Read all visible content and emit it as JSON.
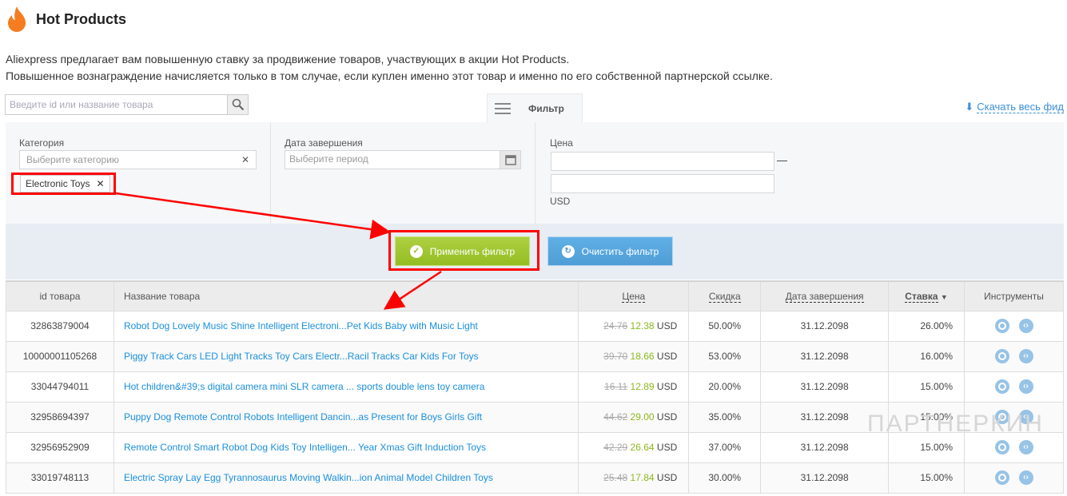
{
  "header": {
    "title": "Hot Products",
    "icon": "flame-icon"
  },
  "intro": [
    "Aliexpress предлагает вам повышенную ставку за продвижение товаров, участвующих в акции Hot Products.",
    "Повышенное вознаграждение начисляется только в том случае, если куплен именно этот товар и именно по его собственной партнерской ссылке."
  ],
  "search": {
    "placeholder": "Введите id или название товара"
  },
  "filter_tab": "Фильтр",
  "download": "Скачать весь фид",
  "filters": {
    "category_label": "Категория",
    "category_placeholder": "Выберите категорию",
    "category_tag": "Electronic Toys",
    "date_label": "Дата завершения",
    "date_placeholder": "Выберите период",
    "price_label": "Цена",
    "price_dash": "—",
    "currency": "USD"
  },
  "buttons": {
    "apply": "Применить фильтр",
    "clear": "Очистить фильтр"
  },
  "table": {
    "headers": [
      "id товара",
      "Название товара",
      "Цена",
      "Скидка",
      "Дата завершения",
      "Ставка",
      "Инструменты"
    ],
    "rows": [
      {
        "id": "32863879004",
        "name": "Robot Dog Lovely Music Shine Intelligent Electroni...Pet Kids Baby with Music Light",
        "old": "24.76",
        "new": "12.38",
        "cur": "USD",
        "discount": "50.00%",
        "end": "31.12.2098",
        "rate": "26.00%"
      },
      {
        "id": "10000001105268",
        "name": "Piggy Track Cars LED Light Tracks Toy Cars Electr...Racil Tracks Car Kids For Toys",
        "old": "39.70",
        "new": "18.66",
        "cur": "USD",
        "discount": "53.00%",
        "end": "31.12.2098",
        "rate": "16.00%"
      },
      {
        "id": "33044794011",
        "name": "Hot children&#39;s digital camera mini SLR camera ... sports double lens toy camera",
        "old": "16.11",
        "new": "12.89",
        "cur": "USD",
        "discount": "20.00%",
        "end": "31.12.2098",
        "rate": "15.00%"
      },
      {
        "id": "32958694397",
        "name": "Puppy Dog Remote Control Robots Intelligent Dancin...as Present for Boys Girls Gift",
        "old": "44.62",
        "new": "29.00",
        "cur": "USD",
        "discount": "35.00%",
        "end": "31.12.2098",
        "rate": "15.00%"
      },
      {
        "id": "32956952909",
        "name": "Remote Control Smart Robot Dog Kids Toy Intelligen... Year Xmas Gift Induction Toys",
        "old": "42.29",
        "new": "26.64",
        "cur": "USD",
        "discount": "37.00%",
        "end": "31.12.2098",
        "rate": "15.00%"
      },
      {
        "id": "33019748113",
        "name": "Electric Spray Lay Egg Tyrannosaurus Moving Walkin...ion Animal Model Children Toys",
        "old": "25.48",
        "new": "17.84",
        "cur": "USD",
        "discount": "30.00%",
        "end": "31.12.2098",
        "rate": "15.00%"
      }
    ]
  },
  "watermark": "ПАРТНЕРКИН"
}
